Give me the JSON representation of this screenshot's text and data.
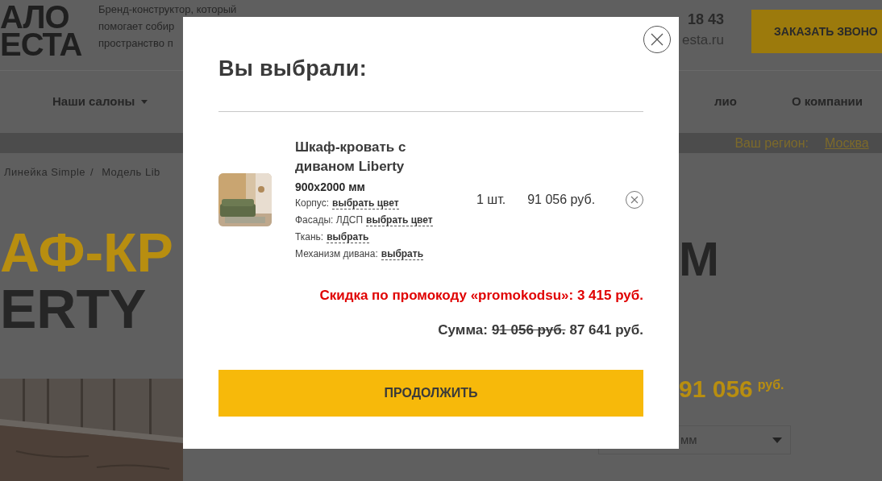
{
  "header": {
    "logo_lines": [
      "АЛО",
      "ЕСТА"
    ],
    "tagline_lines": [
      "Бренд-конструктор, который",
      "помогает собир",
      "пространство п"
    ],
    "phone": "18 43",
    "site": "esta.ru",
    "callback_button": "ЗАКАЗАТЬ ЗВОНО"
  },
  "nav": [
    {
      "label": "Наши салоны",
      "dropdown": true
    },
    {
      "label": "лио",
      "dropdown": false
    },
    {
      "label": "О компании",
      "dropdown": false
    }
  ],
  "region": {
    "label": "Ваш регион:",
    "value": "Москва"
  },
  "breadcrumbs": {
    "items": [
      "Линейка Simple",
      "Модель Lib"
    ],
    "separator": "/"
  },
  "hero": {
    "title_lines": [
      "АФ-КР",
      "ERTY"
    ],
    "title_right": "М",
    "price": "91 056",
    "currency": "руб.",
    "size_select": "мм"
  },
  "modal": {
    "title": "Вы выбрали:",
    "items": [
      {
        "name": "Шкаф-кровать с диваном Liberty",
        "size": "900x2000 мм",
        "options": [
          {
            "label": "Корпус:",
            "link": "выбрать цвет"
          },
          {
            "label": "Фасады: ЛДСП",
            "link": "выбрать цвет"
          },
          {
            "label": "Ткань:",
            "link": "выбрать"
          },
          {
            "label": "Механизм дивана:",
            "link": "выбрать"
          }
        ],
        "quantity": "1 шт.",
        "price": "91 056 руб."
      }
    ],
    "discount": "Скидка по промокоду «promokodsu»: 3 415 руб.",
    "total": {
      "label": "Сумма:",
      "old": "91 056 руб.",
      "new": "87 641 руб."
    },
    "continue_button": "ПРОДОЛЖИТЬ"
  }
}
